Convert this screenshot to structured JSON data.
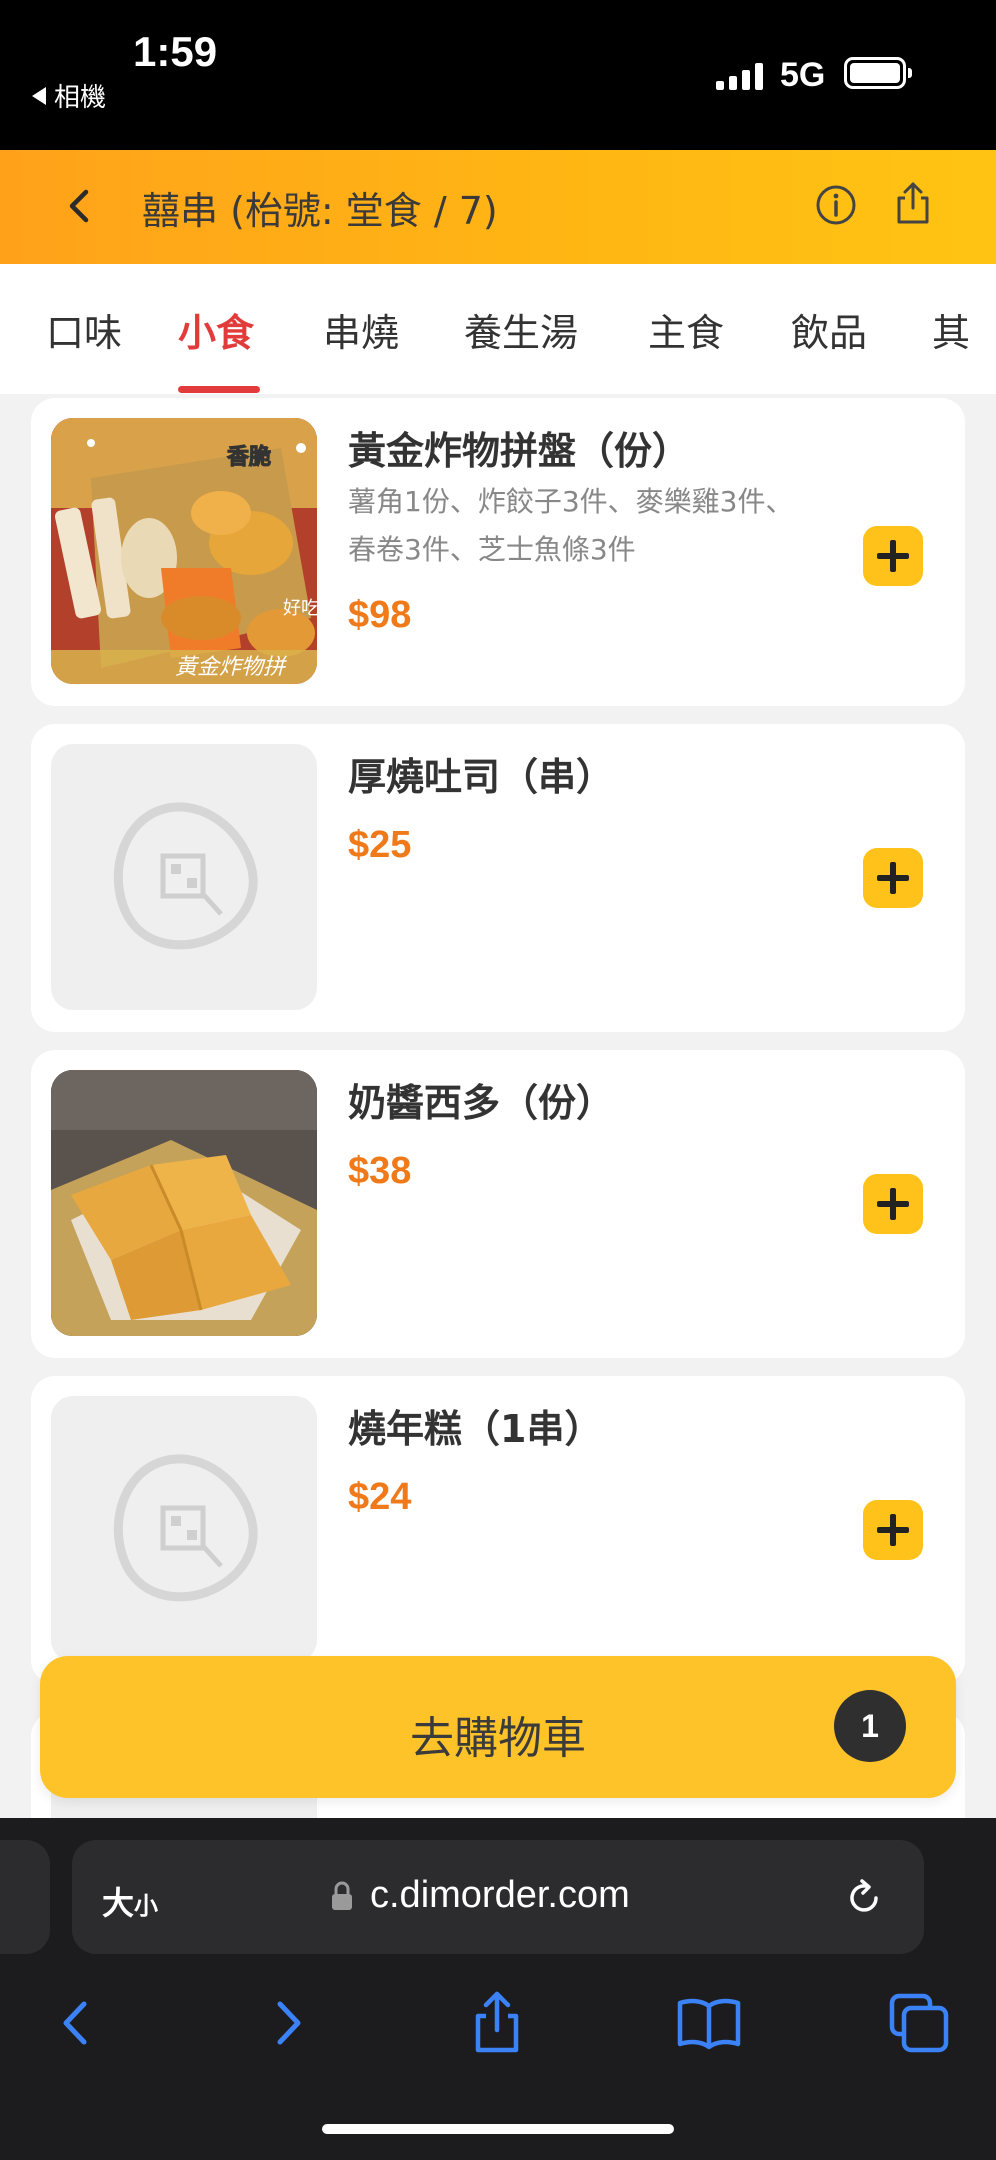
{
  "status_bar": {
    "time": "1:59",
    "back_label": "相機",
    "network": "5G"
  },
  "header": {
    "title": "囍串 (枱號: 堂食 / 7)"
  },
  "tabs": [
    {
      "label": "口味"
    },
    {
      "label": "小食"
    },
    {
      "label": "串燒"
    },
    {
      "label": "養生湯"
    },
    {
      "label": "主食"
    },
    {
      "label": "飲品"
    },
    {
      "label": "其"
    }
  ],
  "active_tab": "小食",
  "items": [
    {
      "name": "黃金炸物拼盤（份）",
      "desc": "薯角1份、炸餃子3件、麥樂雞3件、春卷3件、芝士魚條3件",
      "price": "$98",
      "image": "fried-platter-photo",
      "image_caption": "黃金炸物拼"
    },
    {
      "name": "厚燒吐司（串）",
      "desc": "",
      "price": "$25",
      "image": "placeholder-logo"
    },
    {
      "name": "奶醬西多（份）",
      "desc": "",
      "price": "$38",
      "image": "french-toast-photo"
    },
    {
      "name": "燒年糕（1串）",
      "desc": "",
      "price": "$24",
      "image": "placeholder-logo"
    }
  ],
  "cart": {
    "label": "去購物車",
    "count": "1"
  },
  "browser": {
    "text_size": "大",
    "text_size_small": "小",
    "url": "c.dimorder.com"
  },
  "colors": {
    "accent": "#ffb713",
    "active_tab": "#e23b3b",
    "price": "#f07a1a",
    "add_button": "#ffc21a",
    "cart_button": "#ffc32a",
    "browser_icon": "#3b82f6"
  }
}
